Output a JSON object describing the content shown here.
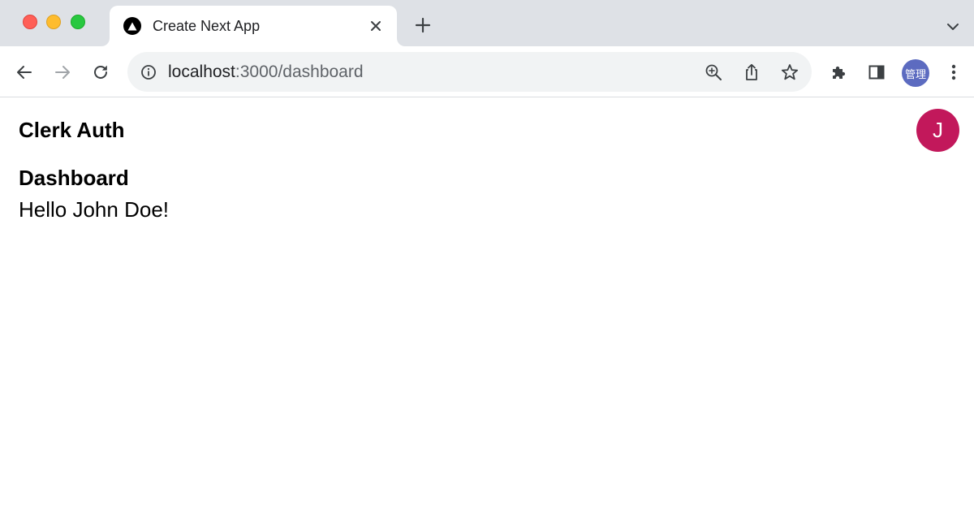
{
  "window": {
    "controls": [
      "close",
      "minimize",
      "maximize"
    ]
  },
  "tab": {
    "title": "Create Next App",
    "favicon": "nextjs-triangle-icon"
  },
  "toolbar": {
    "url_host": "localhost",
    "url_path": ":3000/dashboard",
    "profile_label": "管理"
  },
  "page": {
    "brand": "Clerk Auth",
    "avatar_initial": "J",
    "heading": "Dashboard",
    "greeting": "Hello John Doe!"
  },
  "colors": {
    "avatar_bg": "#c2185b",
    "profile_bg": "#5c6bc0",
    "tabstrip_bg": "#dee1e6"
  }
}
